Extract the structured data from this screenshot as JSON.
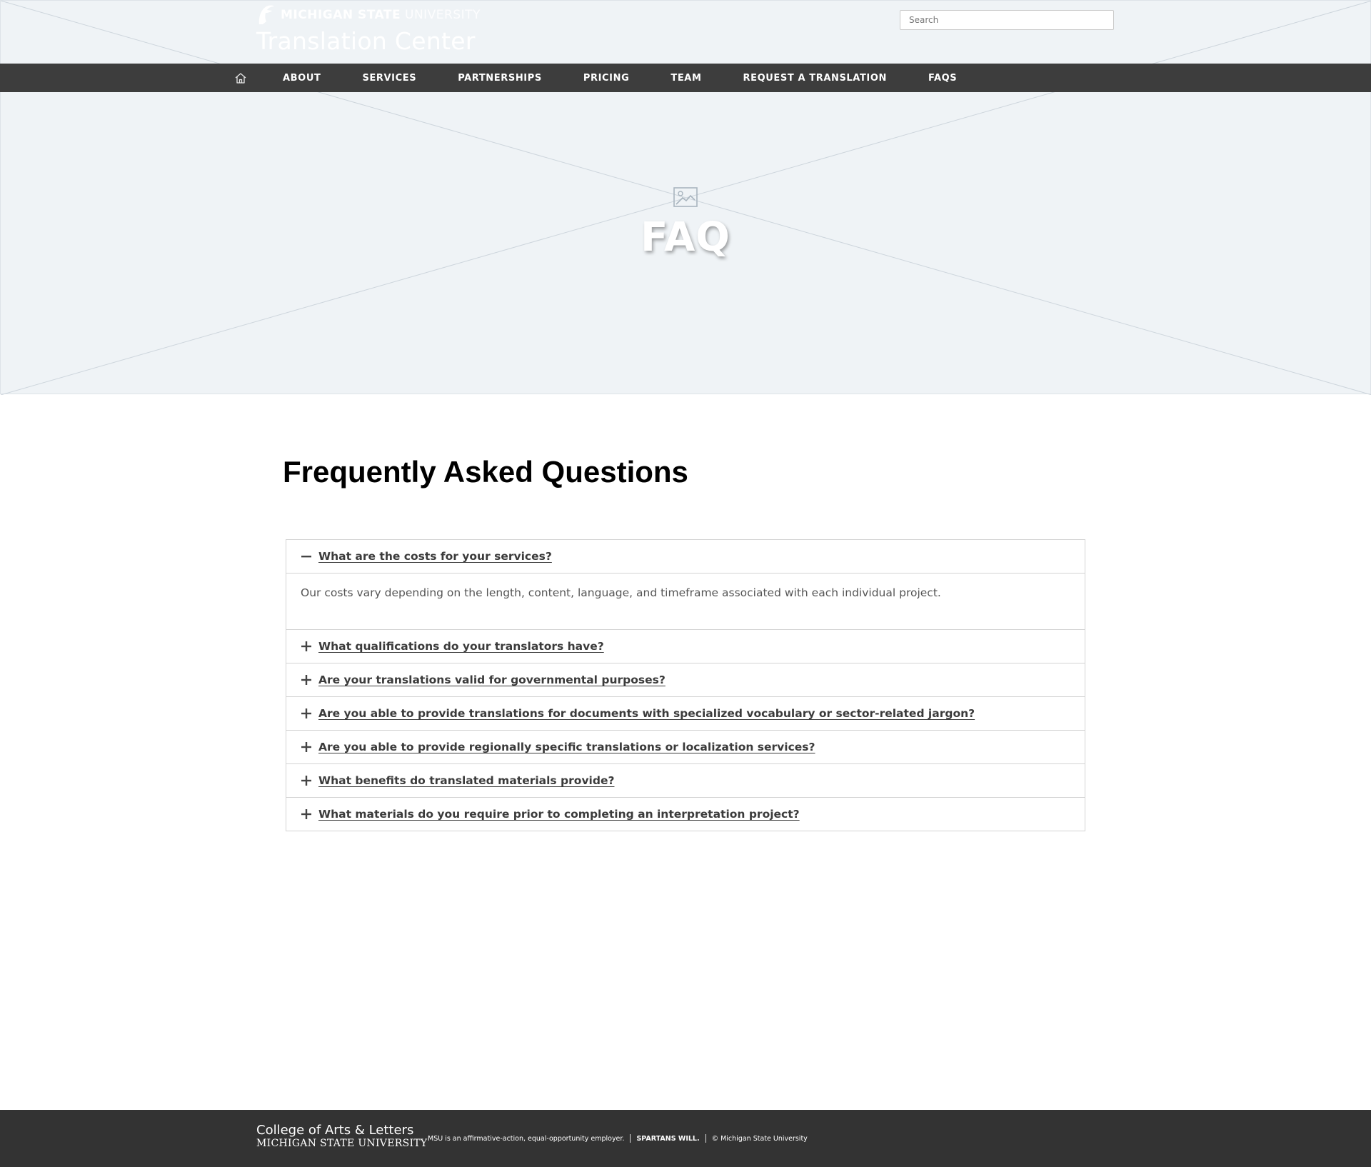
{
  "colors": {
    "placeholder_bg": "#eff3f6",
    "nav_bg": "#3d3d3d",
    "footer_bg": "#333333",
    "link_text": "#3b3b3b"
  },
  "header": {
    "university_bold": "MICHIGAN STATE",
    "university_light": "UNIVERSITY",
    "site_title": "Translation Center",
    "search_placeholder": "Search",
    "logo_icon": "spartan-helmet-icon"
  },
  "nav": {
    "home_icon": "home-icon",
    "items": [
      {
        "label": "ABOUT"
      },
      {
        "label": "SERVICES"
      },
      {
        "label": "PARTNERSHIPS"
      },
      {
        "label": "PRICING"
      },
      {
        "label": "TEAM"
      },
      {
        "label": "REQUEST A TRANSLATION"
      },
      {
        "label": "FAQS"
      }
    ]
  },
  "hero": {
    "title": "FAQ",
    "icon": "image-placeholder-icon"
  },
  "main": {
    "heading": "Frequently Asked Questions",
    "faqs": [
      {
        "question": "What are the costs for your services?",
        "expanded": true,
        "answer": "Our costs vary depending on the length, content, language, and timeframe associated with each individual project."
      },
      {
        "question": "What qualifications do your translators have?",
        "expanded": false
      },
      {
        "question": "Are your translations valid for governmental purposes?",
        "expanded": false
      },
      {
        "question": "Are you able to provide translations for documents with specialized vocabulary or sector-related jargon?",
        "expanded": false
      },
      {
        "question": "Are you able to provide regionally specific translations or localization services?",
        "expanded": false
      },
      {
        "question": "What benefits do translated materials provide?",
        "expanded": false
      },
      {
        "question": "What materials do you require prior to completing an interpretation project?",
        "expanded": false
      }
    ]
  },
  "footer": {
    "college": "College of Arts & Letters",
    "university": "MICHIGAN STATE UNIVERSITY",
    "eeo": "MSU is an affirmative-action, equal-opportunity employer.",
    "spartans": "SPARTANS WILL.",
    "copyright": "© Michigan State University"
  }
}
